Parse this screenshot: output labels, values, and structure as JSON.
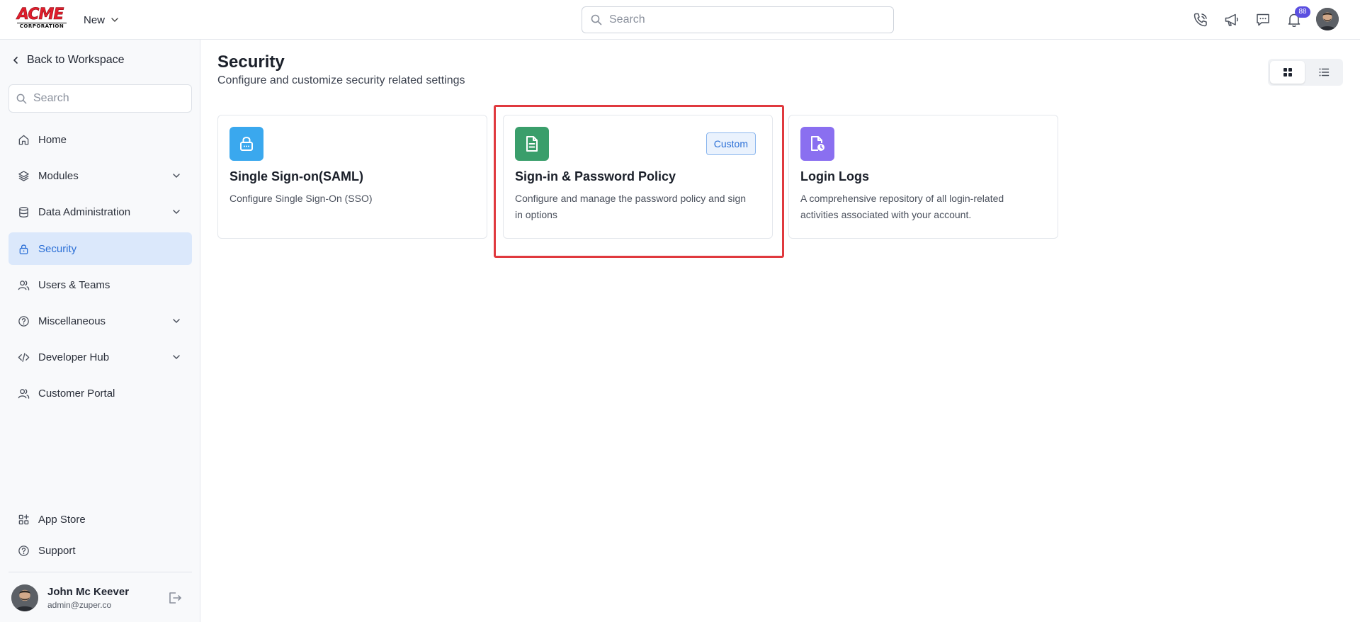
{
  "header": {
    "logo_text": "ACME",
    "logo_subtext": "CORPORATION",
    "new_label": "New",
    "search_placeholder": "Search",
    "notification_count": "88",
    "icons": [
      "phone-icon",
      "megaphone-icon",
      "chat-icon",
      "bell-icon"
    ]
  },
  "sidebar": {
    "back_label": "Back to Workspace",
    "search_placeholder": "Search",
    "items": [
      {
        "label": "Home",
        "icon": "home-icon",
        "expandable": false,
        "active": false
      },
      {
        "label": "Modules",
        "icon": "layers-icon",
        "expandable": true,
        "active": false
      },
      {
        "label": "Data Administration",
        "icon": "database-icon",
        "expandable": true,
        "active": false
      },
      {
        "label": "Security",
        "icon": "lock-icon",
        "expandable": false,
        "active": true
      },
      {
        "label": "Users & Teams",
        "icon": "users-icon",
        "expandable": false,
        "active": false
      },
      {
        "label": "Miscellaneous",
        "icon": "help-circle-icon",
        "expandable": true,
        "active": false
      },
      {
        "label": "Developer Hub",
        "icon": "code-icon",
        "expandable": true,
        "active": false
      },
      {
        "label": "Customer Portal",
        "icon": "users-icon",
        "expandable": false,
        "active": false
      }
    ],
    "footer_items": [
      {
        "label": "App Store",
        "icon": "apps-icon"
      },
      {
        "label": "Support",
        "icon": "help-circle-icon"
      }
    ],
    "user": {
      "name": "John Mc Keever",
      "email": "admin@zuper.co"
    }
  },
  "main": {
    "title": "Security",
    "subtitle": "Configure and customize security related settings",
    "view_mode": "grid",
    "cards": [
      {
        "title": "Single Sign-on(SAML)",
        "description": "Configure Single Sign-On (SSO)",
        "icon": "lock-icon",
        "icon_color": "#3aa8ee",
        "tag": ""
      },
      {
        "title": "Sign-in & Password Policy",
        "description": "Configure and manage the password policy and sign in options",
        "icon": "document-icon",
        "icon_color": "#3a9e6b",
        "tag": "Custom"
      },
      {
        "title": "Login Logs",
        "description": "A comprehensive repository of all login-related activities associated with your account.",
        "icon": "file-clock-icon",
        "icon_color": "#8a6ff0",
        "tag": ""
      }
    ]
  },
  "colors": {
    "accent": "#2b6fd6",
    "active_nav_bg": "#dbe8fb",
    "highlight": "#e0393e"
  }
}
